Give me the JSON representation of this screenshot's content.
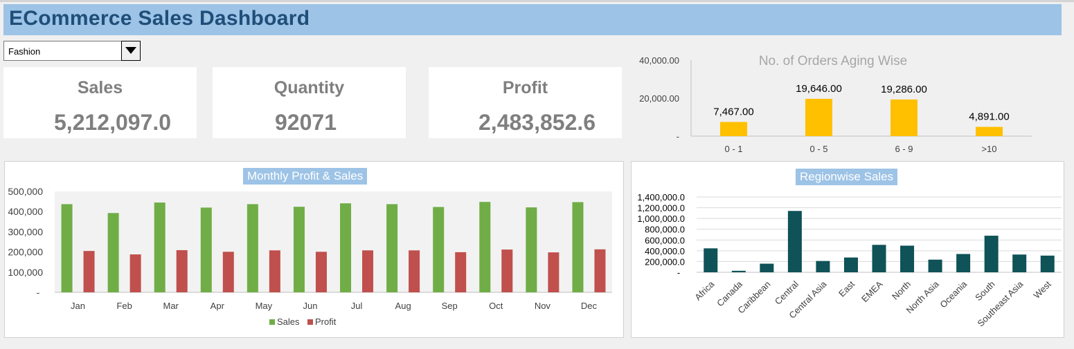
{
  "dashboard": {
    "title": "ECommerce Sales Dashboard"
  },
  "filter": {
    "selected": "Fashion"
  },
  "kpis": {
    "sales_label": "Sales",
    "sales_value": "5,212,097.0",
    "quantity_label": "Quantity",
    "quantity_value": "92071",
    "profit_label": "Profit",
    "profit_value": "2,483,852.6"
  },
  "colors": {
    "banner": "#9dc3e6",
    "title_text": "#1f4e79",
    "sales": "#70ad47",
    "profit": "#c0504d",
    "aging_bar": "#ffc000",
    "region_bar": "#0f5257"
  },
  "chart_data": [
    {
      "id": "aging",
      "type": "bar",
      "title": "No. of Orders Aging Wise",
      "categories": [
        "0 - 1",
        "0 - 5",
        "6 - 9",
        ">10"
      ],
      "values": [
        7467,
        19646,
        19286,
        4891
      ],
      "data_labels": [
        "7,467.00",
        "19,646.00",
        "19,286.00",
        "4,891.00"
      ],
      "y_ticks": [
        "-",
        "20,000.00",
        "40,000.00"
      ],
      "ylim": [
        0,
        40000
      ],
      "grid": false
    },
    {
      "id": "monthly",
      "type": "bar",
      "title": "Monthly Profit & Sales",
      "categories": [
        "Jan",
        "Feb",
        "Mar",
        "Apr",
        "May",
        "Jun",
        "Jul",
        "Aug",
        "Sep",
        "Oct",
        "Nov",
        "Dec"
      ],
      "series": [
        {
          "name": "Sales",
          "values": [
            437000,
            393000,
            445000,
            420000,
            437000,
            424000,
            441000,
            437000,
            423000,
            448000,
            421000,
            447000
          ]
        },
        {
          "name": "Profit",
          "values": [
            205000,
            188000,
            209000,
            201000,
            208000,
            201000,
            208000,
            208000,
            199000,
            212000,
            198000,
            213000
          ]
        }
      ],
      "y_ticks": [
        "-",
        "100,000",
        "200,000",
        "300,000",
        "400,000",
        "500,000"
      ],
      "ylim": [
        0,
        500000
      ],
      "legend": "bottom",
      "grid": false
    },
    {
      "id": "regions",
      "type": "bar",
      "title": "Regionwise Sales",
      "categories": [
        "Africa",
        "Canada",
        "Caribbean",
        "Central",
        "Central Asia",
        "East",
        "EMEA",
        "North",
        "North Asia",
        "Oceania",
        "South",
        "Southeast Asia",
        "West"
      ],
      "values": [
        445000,
        28000,
        160000,
        1140000,
        210000,
        275000,
        510000,
        495000,
        235000,
        340000,
        680000,
        330000,
        310000
      ],
      "y_ticks": [
        "-",
        "200,000.0",
        "400,000.0",
        "600,000.0",
        "800,000.0",
        "1,000,000.0",
        "1,200,000.0",
        "1,400,000.0"
      ],
      "ylim": [
        0,
        1400000
      ],
      "grid": true
    }
  ]
}
